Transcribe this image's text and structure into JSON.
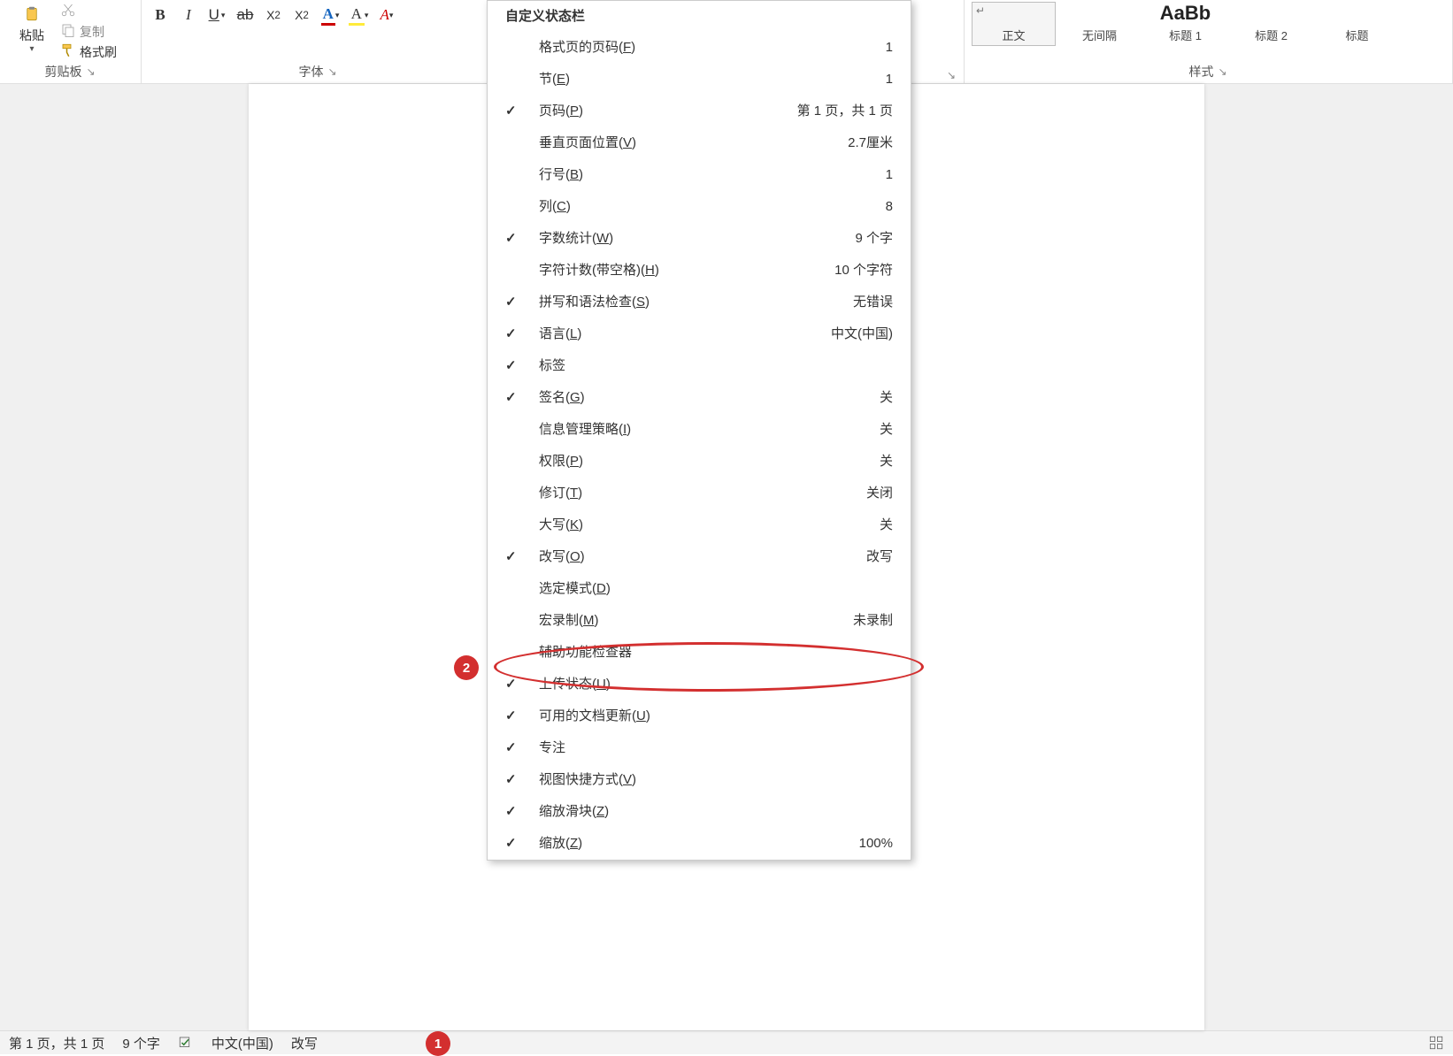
{
  "ribbon": {
    "clipboard": {
      "group_label": "剪贴板",
      "paste_label": "粘贴",
      "copy_label": "复制",
      "format_painter_label": "格式刷"
    },
    "font": {
      "group_label": "字体",
      "bold": "B",
      "italic": "I",
      "underline": "U",
      "strike": "ab",
      "subscript": "X",
      "sub_2": "2",
      "superscript": "X",
      "sup_2": "2",
      "font_color": "A",
      "highlight": "A",
      "clear": "A"
    },
    "styles": {
      "group_label": "样式",
      "items": [
        {
          "preview": "",
          "name": "正文"
        },
        {
          "preview": "",
          "name": "无间隔"
        },
        {
          "preview": "AaBb",
          "name": "标题 1"
        },
        {
          "preview": "",
          "name": "标题 2"
        },
        {
          "preview": "",
          "name": "标题"
        }
      ]
    }
  },
  "context_menu": {
    "title": "自定义状态栏",
    "items": [
      {
        "checked": false,
        "label_pre": "格式页的页码(",
        "hotkey": "F",
        "label_post": ")",
        "value": "1"
      },
      {
        "checked": false,
        "label_pre": "节(",
        "hotkey": "E",
        "label_post": ")",
        "value": "1"
      },
      {
        "checked": true,
        "label_pre": "页码(",
        "hotkey": "P",
        "label_post": ")",
        "value": "第 1 页，共 1 页"
      },
      {
        "checked": false,
        "label_pre": "垂直页面位置(",
        "hotkey": "V",
        "label_post": ")",
        "value": "2.7厘米"
      },
      {
        "checked": false,
        "label_pre": "行号(",
        "hotkey": "B",
        "label_post": ")",
        "value": "1"
      },
      {
        "checked": false,
        "label_pre": "列(",
        "hotkey": "C",
        "label_post": ")",
        "value": "8"
      },
      {
        "checked": true,
        "label_pre": "字数统计(",
        "hotkey": "W",
        "label_post": ")",
        "value": "9 个字"
      },
      {
        "checked": false,
        "label_pre": "字符计数(带空格)(",
        "hotkey": "H",
        "label_post": ")",
        "value": "10 个字符"
      },
      {
        "checked": true,
        "label_pre": "拼写和语法检查(",
        "hotkey": "S",
        "label_post": ")",
        "value": "无错误"
      },
      {
        "checked": true,
        "label_pre": "语言(",
        "hotkey": "L",
        "label_post": ")",
        "value": "中文(中国)"
      },
      {
        "checked": true,
        "label_pre": "标签",
        "hotkey": "",
        "label_post": "",
        "value": ""
      },
      {
        "checked": true,
        "label_pre": "签名(",
        "hotkey": "G",
        "label_post": ")",
        "value": "关"
      },
      {
        "checked": false,
        "label_pre": "信息管理策略(",
        "hotkey": "I",
        "label_post": ")",
        "value": "关"
      },
      {
        "checked": false,
        "label_pre": "权限(",
        "hotkey": "P",
        "label_post": ")",
        "value": "关"
      },
      {
        "checked": false,
        "label_pre": "修订(",
        "hotkey": "T",
        "label_post": ")",
        "value": "关闭"
      },
      {
        "checked": false,
        "label_pre": "大写(",
        "hotkey": "K",
        "label_post": ")",
        "value": "关"
      },
      {
        "checked": true,
        "label_pre": "改写(",
        "hotkey": "O",
        "label_post": ")",
        "value": "改写"
      },
      {
        "checked": false,
        "label_pre": "选定模式(",
        "hotkey": "D",
        "label_post": ")",
        "value": ""
      },
      {
        "checked": false,
        "label_pre": "宏录制(",
        "hotkey": "M",
        "label_post": ")",
        "value": "未录制"
      },
      {
        "checked": false,
        "label_pre": "辅助功能检查器",
        "hotkey": "",
        "label_post": "",
        "value": ""
      },
      {
        "checked": true,
        "label_pre": "上传状态(",
        "hotkey": "U",
        "label_post": ")",
        "value": ""
      },
      {
        "checked": true,
        "label_pre": "可用的文档更新(",
        "hotkey": "U",
        "label_post": ")",
        "value": ""
      },
      {
        "checked": true,
        "label_pre": "专注",
        "hotkey": "",
        "label_post": "",
        "value": ""
      },
      {
        "checked": true,
        "label_pre": "视图快捷方式(",
        "hotkey": "V",
        "label_post": ")",
        "value": ""
      },
      {
        "checked": true,
        "label_pre": "缩放滑块(",
        "hotkey": "Z",
        "label_post": ")",
        "value": ""
      },
      {
        "checked": true,
        "label_pre": "缩放(",
        "hotkey": "Z",
        "label_post": ")",
        "value": "100%"
      }
    ]
  },
  "status_bar": {
    "page": "第 1 页，共 1 页",
    "words": "9 个字",
    "language": "中文(中国)",
    "overtype": "改写"
  },
  "annotations": {
    "1": "1",
    "2": "2"
  }
}
